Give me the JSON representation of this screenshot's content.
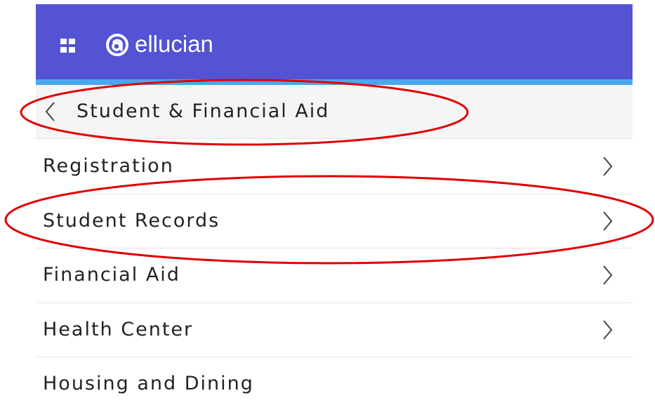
{
  "header": {
    "app_launcher_icon": "grid-icon",
    "logo_icon": "ellucian-at-mark-icon",
    "brand_name": "ellucian",
    "colors": {
      "bar": "#5353d3",
      "accent_strip": "#4aa6ee"
    }
  },
  "navigation": {
    "back_icon": "chevron-left-icon",
    "current_section": "Student & Financial Aid"
  },
  "menu": {
    "items": [
      {
        "label": "Registration",
        "icon": "chevron-right-icon"
      },
      {
        "label": "Student Records",
        "icon": "chevron-right-icon"
      },
      {
        "label": "Financial Aid",
        "icon": "chevron-right-icon"
      },
      {
        "label": "Health Center",
        "icon": "chevron-right-icon"
      },
      {
        "label": "Housing and Dining",
        "icon": ""
      }
    ]
  },
  "annotations": {
    "highlight_color": "#e00000",
    "highlighted_items": [
      "Student & Financial Aid",
      "Student Records"
    ]
  }
}
